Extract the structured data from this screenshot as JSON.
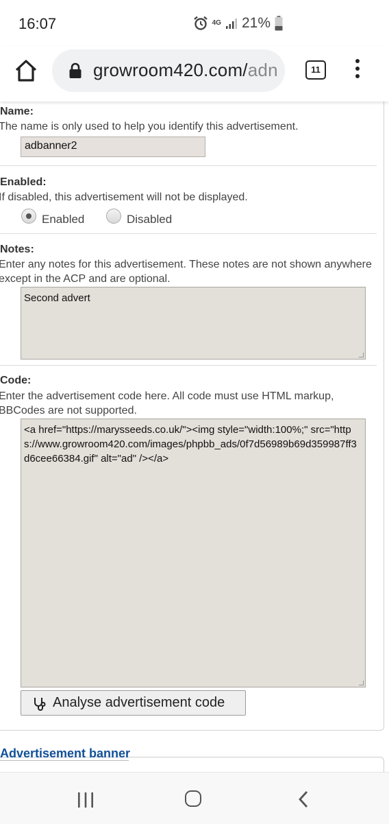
{
  "status_bar": {
    "time": "16:07",
    "network": "4G",
    "battery": "21%",
    "icons": [
      "alarm-icon",
      "network-4g-icon",
      "signal-icon",
      "battery-icon"
    ]
  },
  "browser": {
    "url_main": "growroom420.com/",
    "url_rest": "adn",
    "tab_count": "11",
    "icons": [
      "home-icon",
      "lock-icon",
      "tabs-icon",
      "overflow-menu-icon"
    ]
  },
  "form": {
    "name": {
      "label": "Name:",
      "description": "The name is only used to help you identify this advertisement.",
      "value": "adbanner2"
    },
    "enabled": {
      "label": "Enabled:",
      "description": "If disabled, this advertisement will not be displayed.",
      "options": [
        "Enabled",
        "Disabled"
      ],
      "selected": "Enabled"
    },
    "notes": {
      "label": "Notes:",
      "description": "Enter any notes for this advertisement. These notes are not shown anywhere except in the ACP and are optional.",
      "value": "Second advert"
    },
    "code": {
      "label": "Code:",
      "description": "Enter the advertisement code here. All code must use HTML markup, BBCodes are not supported.",
      "value": "<a href=\"https://marysseeds.co.uk/\"><img style=\"width:100%;\" src=\"https://www.growroom420.com/images/phpbb_ads/0f7d56989b69d359987ff3d6cee66384.gif\" alt=\"ad\" /></a>",
      "analyse_button": "Analyse advertisement code"
    },
    "next_section": "Advertisement banner"
  },
  "colors": {
    "link_heading": "#115098",
    "input_bg": "#e6e1dc"
  },
  "nav_bar": {
    "icons": [
      "recent-apps-icon",
      "home-nav-icon",
      "back-icon"
    ]
  }
}
